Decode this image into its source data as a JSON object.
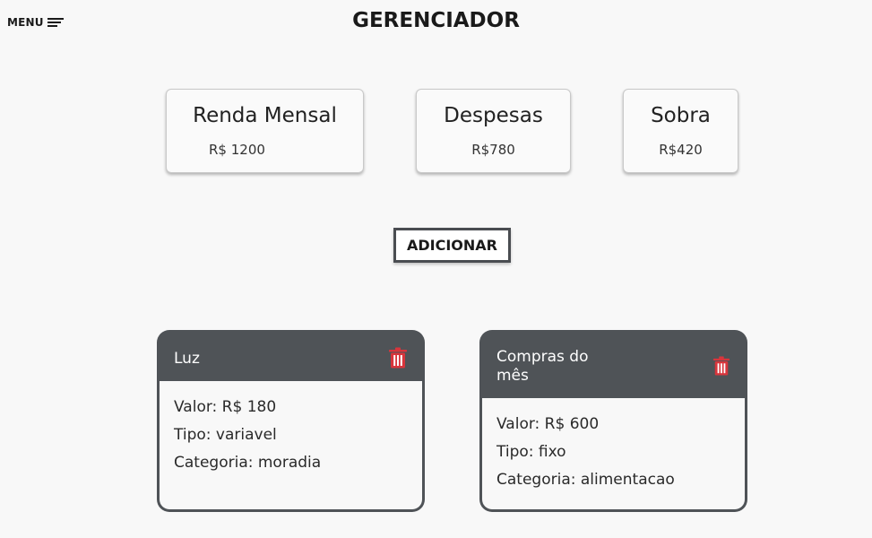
{
  "header": {
    "menu_label": "MENU",
    "title": "GERENCIADOR"
  },
  "summary": {
    "renda": {
      "title": "Renda Mensal",
      "value": "R$ 1200"
    },
    "despesas": {
      "title": "Despesas",
      "value": "R$780"
    },
    "sobra": {
      "title": "Sobra",
      "value": "R$420"
    }
  },
  "actions": {
    "add_label": "ADICIONAR"
  },
  "expenses": [
    {
      "name": "Luz",
      "valor": "Valor: R$ 180",
      "tipo": "Tipo: variavel",
      "categoria": "Categoria: moradia",
      "icon": "trash-icon"
    },
    {
      "name": "Compras do mês",
      "valor": "Valor: R$ 600",
      "tipo": "Tipo: fixo",
      "categoria": "Categoria: alimentacao",
      "icon": "trash-icon"
    }
  ],
  "colors": {
    "background": "#f8f8f8",
    "card_header": "#4f5357",
    "delete_icon": "#d8353c",
    "text": "#222222"
  }
}
